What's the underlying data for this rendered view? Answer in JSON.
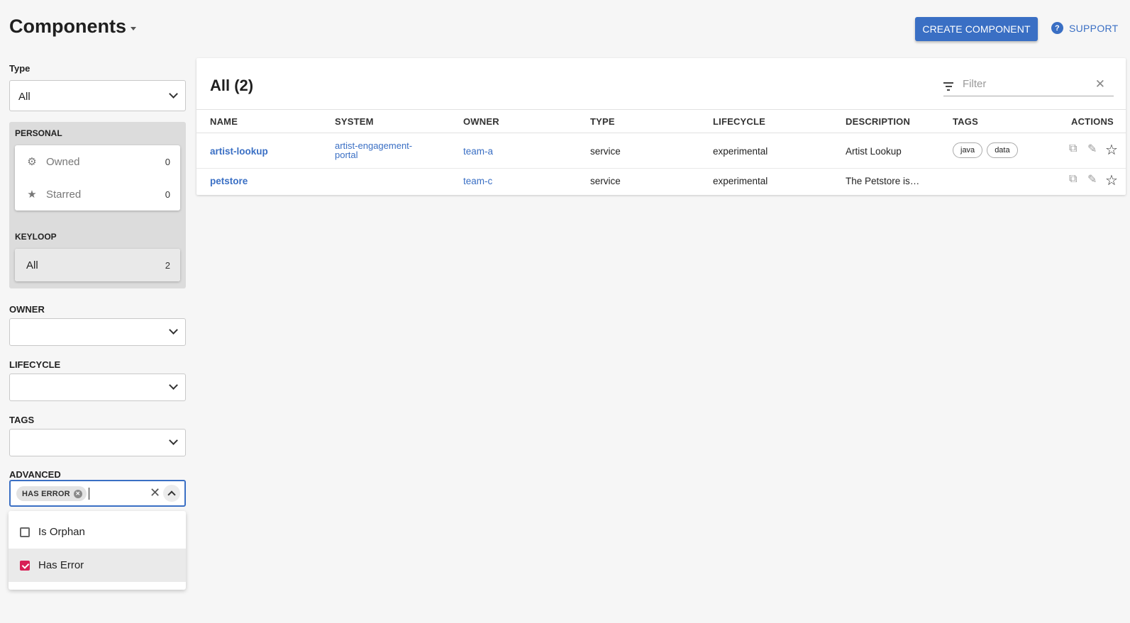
{
  "header": {
    "title": "Components",
    "create_button": "CREATE COMPONENT",
    "support_label": "SUPPORT",
    "help_glyph": "?"
  },
  "sidebar": {
    "type_label": "Type",
    "type_value": "All",
    "personal_label": "PERSONAL",
    "personal_items": [
      {
        "label": "Owned",
        "count": "0",
        "icon": "gear-icon"
      },
      {
        "label": "Starred",
        "count": "0",
        "icon": "star-icon"
      }
    ],
    "org_label": "KEYLOOP",
    "org_items": [
      {
        "label": "All",
        "count": "2"
      }
    ],
    "owner_label": "OWNER",
    "lifecycle_label": "LIFECYCLE",
    "tags_label": "TAGS",
    "advanced_label": "ADVANCED",
    "advanced_chip": "HAS ERROR",
    "advanced_options": [
      {
        "label": "Is Orphan",
        "checked": false
      },
      {
        "label": "Has Error",
        "checked": true
      }
    ]
  },
  "table": {
    "title": "All (2)",
    "filter_placeholder": "Filter",
    "columns": [
      "NAME",
      "SYSTEM",
      "OWNER",
      "TYPE",
      "LIFECYCLE",
      "DESCRIPTION",
      "TAGS",
      "ACTIONS"
    ],
    "rows": [
      {
        "name": "artist-lookup",
        "system_line1": "artist-engagement-",
        "system_line2": "portal",
        "owner": "team-a",
        "type": "service",
        "lifecycle": "experimental",
        "description": "Artist Lookup",
        "tags": [
          "java",
          "data"
        ]
      },
      {
        "name": "petstore",
        "system_line1": "",
        "system_line2": "",
        "owner": "team-c",
        "type": "service",
        "lifecycle": "experimental",
        "description": "The Petstore is…",
        "tags": []
      }
    ]
  },
  "colors": {
    "primary": "#3a6fc4",
    "checkbox_checked": "#d81f55",
    "background": "#f6f6f6"
  }
}
